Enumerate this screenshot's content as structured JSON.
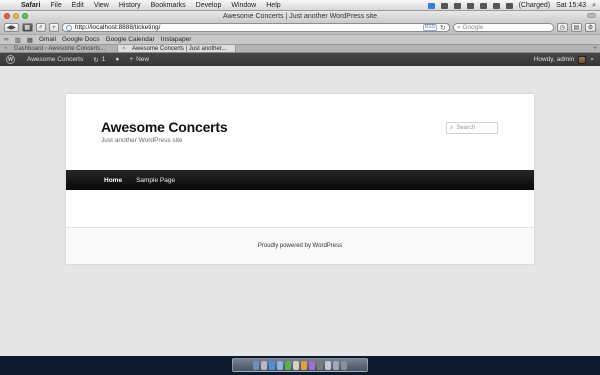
{
  "menubar": {
    "app": "Safari",
    "items": [
      "File",
      "Edit",
      "View",
      "History",
      "Bookmarks",
      "Develop",
      "Window",
      "Help"
    ],
    "battery": "(Charged)",
    "clock": "Sat 15:43"
  },
  "window": {
    "title": "Awesome Concerts | Just another WordPress site"
  },
  "toolbar": {
    "url": "http://localhost:8888/ticketing/",
    "rss_badge": "RSS",
    "search_placeholder": "Google"
  },
  "bookmarks": [
    "Gmail",
    "Google Docs",
    "Google Calendar",
    "Instapaper"
  ],
  "tabs": [
    {
      "label": "Dashboard ‹ Awesome Concerts...",
      "active": false
    },
    {
      "label": "Awesome Concerts | Just another...",
      "active": true
    }
  ],
  "adminbar": {
    "site_name": "Awesome Concerts",
    "updates_count": "1",
    "new_label": "New",
    "howdy": "Howdy, admin"
  },
  "site": {
    "title": "Awesome Concerts",
    "tagline": "Just another WordPress site",
    "search_placeholder": "Search",
    "nav": [
      {
        "label": "Home",
        "active": true
      },
      {
        "label": "Sample Page",
        "active": false
      }
    ],
    "footer": "Proudly powered by WordPress"
  },
  "colors": {
    "admin_bar": "#464646",
    "site_nav": "#151515",
    "desktop": "#0d1a2e",
    "page_bg": "#e6e6e6"
  }
}
